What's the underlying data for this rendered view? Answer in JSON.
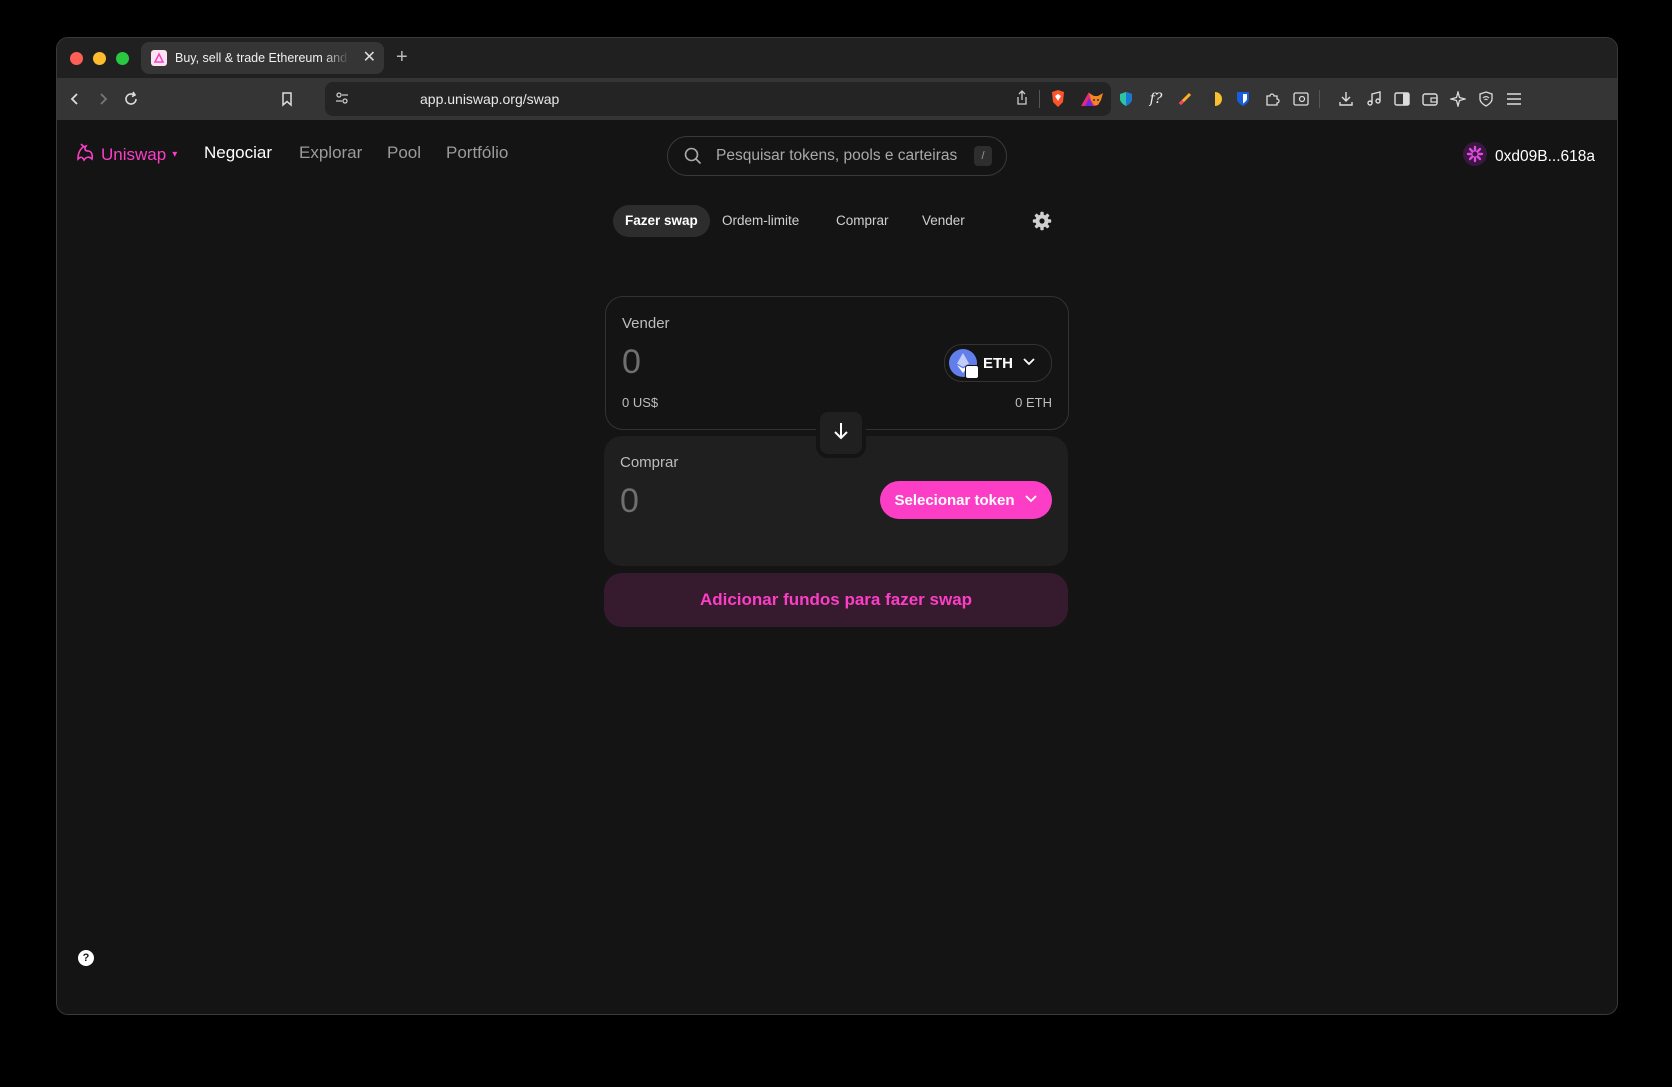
{
  "browser": {
    "tab_title": "Buy, sell & trade Ethereum and",
    "tab_close": "✕",
    "new_tab": "+",
    "url": "app.uniswap.org/swap",
    "search_shortcut": "/"
  },
  "header": {
    "brand": "Uniswap",
    "brand_caret": "▾",
    "nav": [
      "Negociar",
      "Explorar",
      "Pool",
      "Portfólio"
    ],
    "search_placeholder": "Pesquisar tokens, pools e carteiras",
    "search_shortcut": "/",
    "account": "0xd09B...618a"
  },
  "swap": {
    "tabs": [
      "Fazer swap",
      "Ordem-limite",
      "Comprar",
      "Vender"
    ],
    "sell": {
      "label": "Vender",
      "amount": "0",
      "usd": "0 US$",
      "balance": "0 ETH",
      "token": "ETH"
    },
    "buy": {
      "label": "Comprar",
      "amount": "0",
      "select_token": "Selecionar token"
    },
    "cta": "Adicionar fundos para fazer swap"
  },
  "help": "?",
  "colors": {
    "accent": "#fc3ec6",
    "background": "#141414",
    "cta_bg": "#361a2e"
  }
}
